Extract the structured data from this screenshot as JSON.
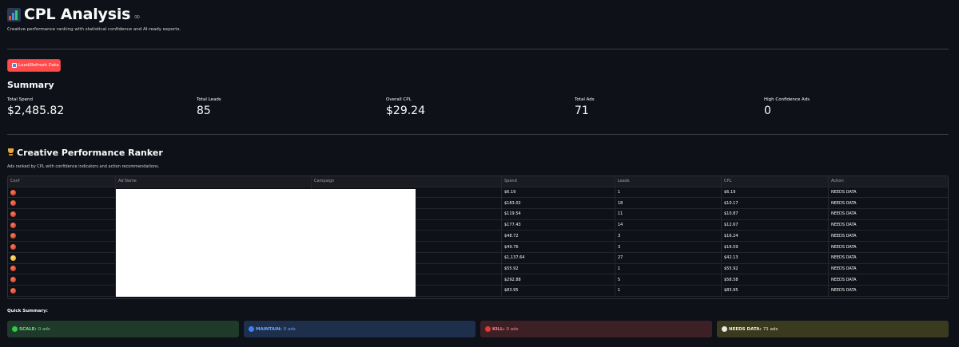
{
  "header": {
    "title": "CPL Analysis",
    "subtitle": "Creative performance ranking with statistical confidence and AI-ready exports."
  },
  "load_button": {
    "label": "Load/Refresh Data"
  },
  "summary": {
    "heading": "Summary",
    "metrics": [
      {
        "label": "Total Spend",
        "value": "$2,485.82"
      },
      {
        "label": "Total Leads",
        "value": "85"
      },
      {
        "label": "Overall CPL",
        "value": "$29.24"
      },
      {
        "label": "Total Ads",
        "value": "71"
      },
      {
        "label": "High Confidence Ads",
        "value": "0"
      }
    ]
  },
  "ranker": {
    "heading": "Creative Performance Ranker",
    "caption": "Ads ranked by CPL with confidence indicators and action recommendations.",
    "columns": [
      "Conf",
      "Ad Name",
      "Campaign",
      "Spend",
      "Leads",
      "CPL",
      "Action"
    ],
    "rows": [
      {
        "conf": "red",
        "spend": "$6.19",
        "leads": "1",
        "cpl": "$6.19",
        "action": "NEEDS DATA"
      },
      {
        "conf": "red",
        "spend": "$183.02",
        "leads": "18",
        "cpl": "$10.17",
        "action": "NEEDS DATA"
      },
      {
        "conf": "red",
        "spend": "$119.54",
        "leads": "11",
        "cpl": "$10.87",
        "action": "NEEDS DATA"
      },
      {
        "conf": "red",
        "spend": "$177.43",
        "leads": "14",
        "cpl": "$12.67",
        "action": "NEEDS DATA"
      },
      {
        "conf": "red",
        "spend": "$48.72",
        "leads": "3",
        "cpl": "$16.24",
        "action": "NEEDS DATA"
      },
      {
        "conf": "red",
        "spend": "$49.76",
        "leads": "3",
        "cpl": "$16.59",
        "action": "NEEDS DATA"
      },
      {
        "conf": "yellow",
        "spend": "$1,137.64",
        "leads": "27",
        "cpl": "$42.13",
        "action": "NEEDS DATA"
      },
      {
        "conf": "red",
        "spend": "$55.92",
        "leads": "1",
        "cpl": "$55.92",
        "action": "NEEDS DATA"
      },
      {
        "conf": "red",
        "spend": "$292.88",
        "leads": "5",
        "cpl": "$58.58",
        "action": "NEEDS DATA"
      },
      {
        "conf": "red",
        "spend": "$83.95",
        "leads": "1",
        "cpl": "$83.95",
        "action": "NEEDS DATA"
      }
    ]
  },
  "quick_summary": {
    "heading": "Quick Summary:",
    "cards": [
      {
        "label": "SCALE:",
        "value": "0 ads",
        "bg": "#1f3a2a",
        "fg": "#7ddc8f",
        "dot": "#2ecc40"
      },
      {
        "label": "MAINTAIN:",
        "value": "0 ads",
        "bg": "#1d2f4a",
        "fg": "#6fa8ff",
        "dot": "#3b82f6"
      },
      {
        "label": "KILL:",
        "value": "0 ads",
        "bg": "#3d2026",
        "fg": "#ff8b8b",
        "dot": "#e53935"
      },
      {
        "label": "NEEDS DATA:",
        "value": "71 ads",
        "bg": "#3a3a1f",
        "fg": "#f5f0c8",
        "dot": "#e8e8e8"
      }
    ]
  }
}
